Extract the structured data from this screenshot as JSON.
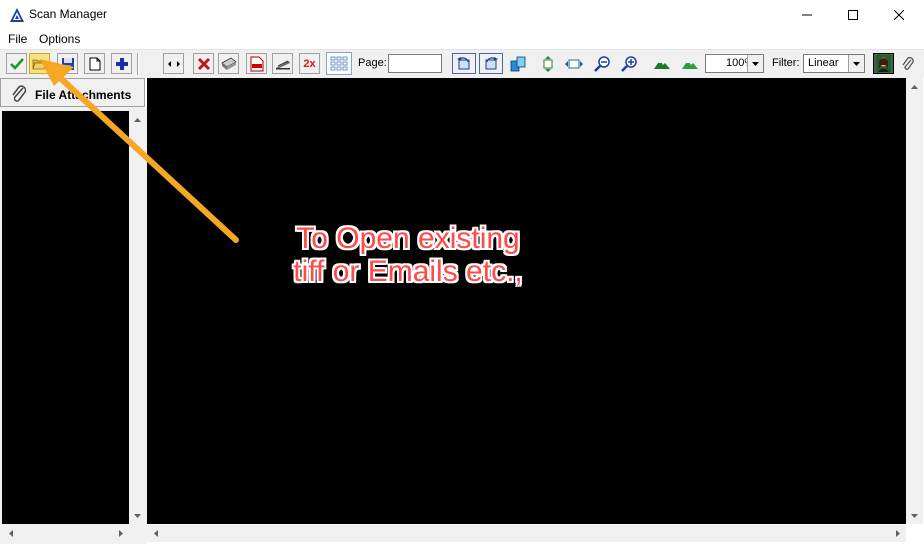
{
  "window": {
    "title": "Scan Manager"
  },
  "menu": {
    "file": "File",
    "options": "Options"
  },
  "toolbar": {
    "double_size_label": "2x",
    "page_label": "Page:",
    "page_value": "",
    "zoom_value": "100%",
    "filter_label": "Filter:",
    "filter_value": "Linear"
  },
  "sidebar": {
    "header_label": "File Attachments"
  },
  "annotation": {
    "line1": "To Open existing",
    "line2": "tiff or Emails etc.,",
    "color": "#ff4a4a",
    "arrow_color": "#f5a623"
  }
}
